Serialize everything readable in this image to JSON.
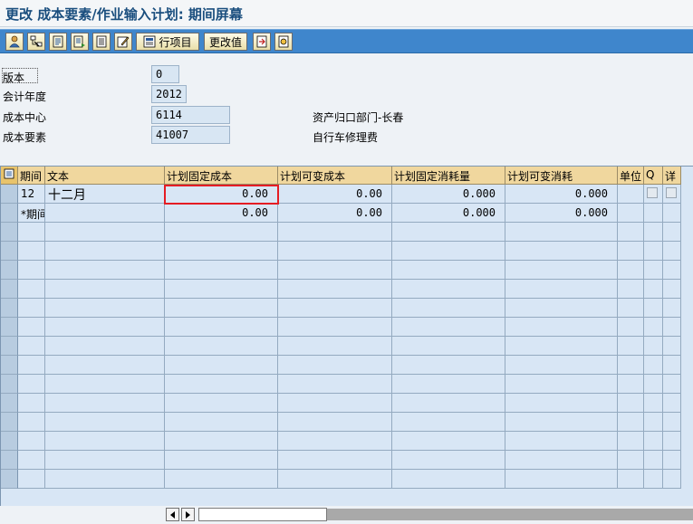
{
  "title": "更改 成本要素/作业输入计划: 期间屏幕",
  "toolbar": {
    "row_items_label": "行项目",
    "change_values_label": "更改值"
  },
  "header": {
    "version": {
      "label": "版本",
      "value": "0"
    },
    "fiscal_year": {
      "label": "会计年度",
      "value": "2012"
    },
    "cost_center": {
      "label": "成本中心",
      "value": "6114",
      "description": "资产归口部门-长春"
    },
    "cost_element": {
      "label": "成本要素",
      "value": "41007",
      "description": "自行车修理费"
    }
  },
  "table": {
    "columns": [
      "期间",
      "文本",
      "计划固定成本",
      "计划可变成本",
      "计划固定消耗量",
      "计划可变消耗",
      "单位",
      "Q",
      "详"
    ],
    "rows": [
      {
        "period": "12",
        "text": "十二月",
        "fixed_cost": "0.00",
        "var_cost": "0.00",
        "fixed_qty": "0.000",
        "var_qty": "0.000",
        "unit": ""
      },
      {
        "period": "*期间",
        "text": "",
        "fixed_cost": "0.00",
        "var_cost": "0.00",
        "fixed_qty": "0.000",
        "var_qty": "0.000",
        "unit": ""
      }
    ]
  },
  "icons": [
    "person-icon",
    "hierarchy-icon",
    "document-icon",
    "document-next-icon",
    "document-list-icon",
    "edit-icon",
    "row-items-icon",
    "save-icon",
    "transfer-icon",
    "select-all-icon",
    "scroll-left-icon",
    "scroll-right-icon"
  ]
}
